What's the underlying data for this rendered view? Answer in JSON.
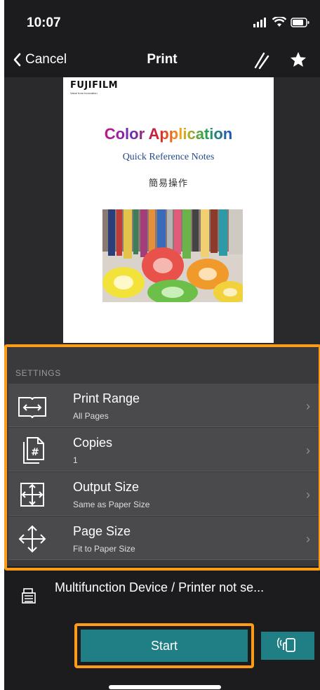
{
  "status_bar": {
    "time": "10:07"
  },
  "navbar": {
    "cancel_label": "Cancel",
    "title": "Print"
  },
  "document": {
    "logo": "FUJIFILM",
    "logo_tagline": "Value from Innovation",
    "title": "Color Application",
    "subtitle": "Quick Reference Notes",
    "subtitle_cn": "簡易操作"
  },
  "settings": {
    "section_title": "SETTINGS",
    "items": [
      {
        "label": "Print Range",
        "value": "All Pages",
        "icon": "book-range-icon"
      },
      {
        "label": "Copies",
        "value": "1",
        "icon": "copies-icon"
      },
      {
        "label": "Output Size",
        "value": "Same as Paper Size",
        "icon": "output-size-icon"
      },
      {
        "label": "Page Size",
        "value": "Fit to Paper Size",
        "icon": "page-size-icon"
      }
    ]
  },
  "device": {
    "label": "Multifunction Device / Printer not se..."
  },
  "actions": {
    "start_label": "Start"
  },
  "colors": {
    "background": "#1c1c1e",
    "row": "#4a4a4d",
    "accent": "#1f7f84",
    "highlight": "#ff9c17"
  }
}
